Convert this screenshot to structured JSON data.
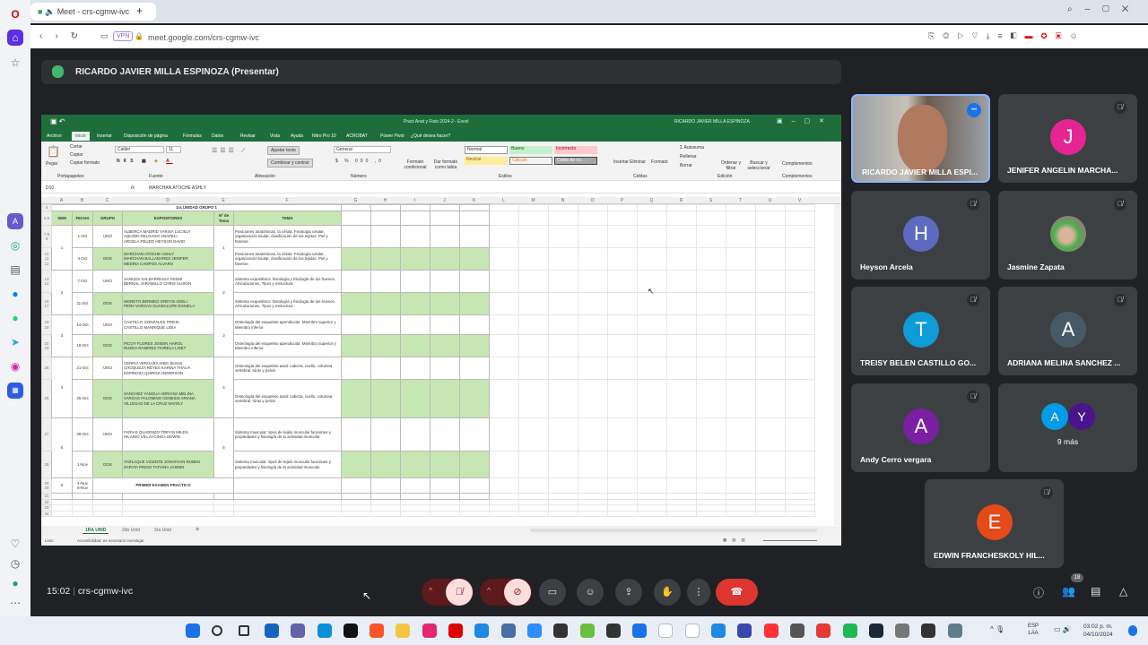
{
  "browser": {
    "tab_title": "Meet - crs-cgmw-ivc",
    "url": "meet.google.com/crs-cgmw-ivc",
    "vpn": "VPN"
  },
  "presenter": {
    "title": "RICARDO JAVIER MILLA ESPINOZA (Presentar)"
  },
  "excel": {
    "title": "Pract Anat y Fisio 2024-2 - Excel",
    "user": "RICARDO JAVIER MILLA ESPINOZA",
    "menu": [
      "Archivo",
      "Inicio",
      "Insertar",
      "Disposición de página",
      "Fórmulas",
      "Datos",
      "Revisar",
      "Vista",
      "Ayuda",
      "Nitro Pro 10",
      "ACROBAT",
      "Power Pivot",
      "¿Qué desea hacer?"
    ],
    "ribbon": {
      "paste": "Pegar",
      "cut": "Cortar",
      "copy": "Copiar",
      "format_painter": "Copiar formato",
      "clipboard": "Portapapeles",
      "font": "Calibri",
      "font_size": "11",
      "font_group": "Fuente",
      "wrap": "Ajustar texto",
      "merge": "Combinar y centrar",
      "align_group": "Alineación",
      "number_format": "General",
      "number_group": "Número",
      "cond_format": "Formato condicional",
      "table_format": "Dar formato como tabla",
      "styles": [
        "Normal",
        "Bueno",
        "Incorrecto",
        "Neutral",
        "Cálculo",
        "Celda de co..."
      ],
      "styles_group": "Estilos",
      "insert": "Insertar",
      "delete": "Eliminar",
      "format": "Formato",
      "cells_group": "Celdas",
      "autosum": "Autosuma",
      "fill": "Rellenar",
      "clear": "Borrar",
      "sort": "Ordenar y filtrar",
      "find": "Buscar y seleccionar",
      "edit_group": "Edición",
      "addins": "Complementos",
      "addins_group": "Complementos"
    },
    "name_box": "D10",
    "formula": "MARCHAN ATOCHE ASHLY",
    "columns": [
      "A",
      "B",
      "C",
      "D",
      "E",
      "F",
      "G",
      "H",
      "I",
      "J",
      "K",
      "L",
      "M",
      "N",
      "O",
      "P",
      "Q",
      "R",
      "S",
      "T",
      "U",
      "V"
    ],
    "sheet_title": "1ra UNIDAD GRUPO 1",
    "headers": {
      "sem": "SEM",
      "fecha": "FECHA",
      "grupo": "GRUPO",
      "expositores": "EXPOSITORES",
      "tema_no": "Nº de Tema",
      "tema": "TEMA"
    },
    "weeks": [
      {
        "sem": "1",
        "tema_no": "1",
        "rows": [
          {
            "rn": "7 8 9",
            "fecha": "1-Oct",
            "grupo": "UNO",
            "expositores": "ALBERCA MADRID YARIXA LUCIELY\nAQUINO DELGADO ANAPELI\nARCELA PEUDO HEYSON DAVID",
            "tema": "Posiciones anatómicas, la célula. Fisiología celular, organización tisular, clasificación de los tejidos. Piel y faneras",
            "green": false
          },
          {
            "rn": "10 11 12",
            "fecha": "4-Oct",
            "grupo": "DOS",
            "expositores": "MARCHAN ATOCHE ASHLY\nMARCHAN BALLADARES JENIFER\nMEDINA CAMPOS ALVARO",
            "tema": "Posiciones anatómicas, la célula. Fisiología celular, organización tisular, clasificación de los tejidos. Piel y faneras",
            "green": true
          }
        ]
      },
      {
        "sem": "2",
        "tema_no": "2",
        "rows": [
          {
            "rn": "13 14",
            "fecha": "7-Oct",
            "grupo": "UNO",
            "expositores": "SANCES SALDARRIAGA YESMI\nBERNAL JARAMILLO CHRIS ALISON",
            "tema": "Sistema esquelético: histología y fisiología de los huesos. Articulaciones, Tipos y estructura",
            "green": false
          },
          {
            "rn": "16 17",
            "fecha": "11-Oct",
            "grupo": "DOS",
            "expositores": "MORETO BERMEO GREYSI ADELI\nPEÑA VARGAS GUADALUPE DANIELA",
            "tema": "Sistema esquelético: histología y fisiología de los huesos. Articulaciones, Tipos y estructura",
            "green": true
          }
        ]
      },
      {
        "sem": "3",
        "tema_no": "3",
        "rows": [
          {
            "rn": "19 20",
            "fecha": "14-Oct",
            "grupo": "UNO",
            "expositores": "CASTILLO GONZALES TREISI\nCASTILLO MANRIQUE LIDIA",
            "tema": "Osteología del esqueleto apendicular: Miembro superior y Miembro inferior",
            "green": false
          },
          {
            "rn": "22 23",
            "fecha": "18-Oct",
            "grupo": "DOS",
            "expositores": "PICOY FLORES JOSEIN HAROL\nRUEDA RAMIREZ FIORELA LISET",
            "tema": "Osteología del esqueleto apendicular: Miembro superior y Miembro inferior",
            "green": true
          }
        ]
      },
      {
        "sem": "4",
        "tema_no": "4",
        "rows": [
          {
            "rn": "25",
            "fecha": "21-Oct",
            "grupo": "UNO",
            "expositores": "CERRO VERGARA ANDI JESUS\nCHOQUEZA REYES KARINA THALIA\nESPINOZA QUIROZ ANDERSON",
            "tema": "Osteología del esqueleto axial: cabeza, cuello, columna vertebral, tórax y pelvis",
            "green": false
          },
          {
            "rn": "26",
            "fecha": "25-Oct",
            "grupo": "DOS",
            "expositores": "SANCHEZ YANGUA ADRIANA MELINA\nVARGAS PALOMINO CENESIS ARIANA\nVILLEGAS DE LA CRUZ NAYELY",
            "tema": "Osteología del esqueleto axial: cabeza, cuello, columna vertebral, tórax y pelvis",
            "green": true
          }
        ]
      },
      {
        "sem": "5",
        "tema_no": "5",
        "rows": [
          {
            "rn": "27",
            "fecha": "28-Oct",
            "grupo": "UNO",
            "expositores": "FARIAS QUARNIZO TREYSI MILEN\nHILARIO VILLAYCINGA EDWIN",
            "tema": "Sistema muscular: tipos de tejido muscular funciones y propiedades y fisiología de la actividad muscular",
            "green": false
          },
          {
            "rn": "28",
            "fecha": "1-Nov",
            "grupo": "DOS",
            "expositores": "YARLAQUE VICENTE JONATHAN RUBEN\nZAPATA PINGO TATIANA JASMIN",
            "tema": "Sistema muscular: tipos de tejido muscular funciones y propiedades y fisiología de la actividad muscular",
            "green": true
          }
        ]
      }
    ],
    "exam": {
      "sem": "6",
      "rn": "29 30",
      "fechas": "4-Nov\n8-Nov",
      "label": "PRIMER EXAMEN PRACTICO"
    },
    "sheet_tabs": [
      "1RA UNID",
      "2do Unid",
      "3ra Unid"
    ],
    "status": {
      "mode": "Listo",
      "accessibility": "Accesibilidad: es necesario investigar"
    }
  },
  "participants": [
    {
      "name": "RICARDO JAVIER MILLA ESPI...",
      "initial": "",
      "color": "#6f7a86",
      "video": true
    },
    {
      "name": "JENIFER ANGELIN MARCHA...",
      "initial": "J",
      "color": "#e52592"
    },
    {
      "name": "Heyson Arcela",
      "initial": "H",
      "color": "#5c6bc0"
    },
    {
      "name": "Jasmine Zapata",
      "initial": "",
      "color": "#8d9a6a",
      "photo": true
    },
    {
      "name": "TREISY BELEN CASTILLO GO...",
      "initial": "T",
      "color": "#0e9bd6"
    },
    {
      "name": "ADRIANA MELINA SANCHEZ ...",
      "initial": "A",
      "color": "#455a64"
    },
    {
      "name": "Andy Cerro vergara",
      "initial": "A",
      "color": "#7b1fa2"
    },
    {
      "name": "9 más",
      "initial": "A",
      "initial2": "Y",
      "color": "#039be5",
      "color2": "#4a148c"
    },
    {
      "name": "EDWIN FRANCHESKOLY HIL...",
      "initial": "E",
      "color": "#e64a19"
    }
  ],
  "meeting": {
    "time": "15:02",
    "code": "crs-cgmw-ivc",
    "participant_count": "18"
  },
  "taskbar": {
    "lang": "ESP",
    "layout": "LAA",
    "clock": "03:02 p. m.",
    "date": "04/10/2024"
  }
}
